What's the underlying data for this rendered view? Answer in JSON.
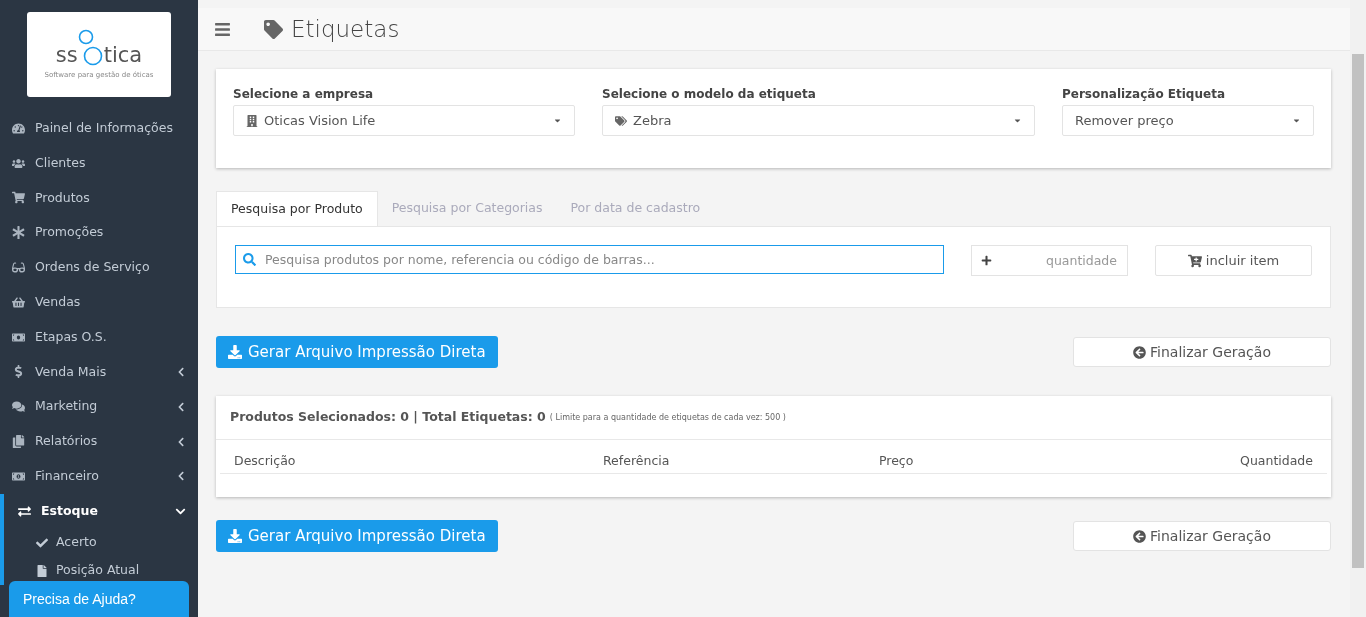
{
  "logo": {
    "name_start": "ss",
    "name_end": "tica",
    "tagline": "Software para gestão de óticas"
  },
  "sidebar": {
    "items": [
      {
        "label": "Painel de Informações",
        "kind": "link",
        "selected": false
      },
      {
        "label": "Clientes",
        "kind": "link",
        "selected": false
      },
      {
        "label": "Produtos",
        "kind": "link",
        "selected": false
      },
      {
        "label": "Promoções",
        "kind": "link",
        "selected": false
      },
      {
        "label": "Ordens de Serviço",
        "kind": "link",
        "selected": false
      },
      {
        "label": "Vendas",
        "kind": "link",
        "selected": false
      },
      {
        "label": "Etapas O.S.",
        "kind": "link",
        "selected": false
      },
      {
        "label": "Venda Mais",
        "kind": "group",
        "selected": false,
        "expanded": false
      },
      {
        "label": "Marketing",
        "kind": "group",
        "selected": false,
        "expanded": false
      },
      {
        "label": "Relatórios",
        "kind": "group",
        "selected": false,
        "expanded": false
      },
      {
        "label": "Financeiro",
        "kind": "group",
        "selected": false,
        "expanded": false
      },
      {
        "label": "Estoque",
        "kind": "group",
        "selected": true,
        "expanded": true,
        "children": [
          {
            "label": "Acerto"
          },
          {
            "label": "Posição Atual"
          }
        ]
      }
    ]
  },
  "help_button": "Precisa de Ajuda?",
  "page_title": "Etiquetas",
  "filters": [
    {
      "label": "Selecione a empresa",
      "value": "Oticas Vision Life"
    },
    {
      "label": "Selecione o modelo da etiqueta",
      "value": "Zebra"
    },
    {
      "label": "Personalização Etiqueta",
      "value": "Remover preço"
    }
  ],
  "tabs": [
    {
      "label": "Pesquisa por Produto",
      "selected": true
    },
    {
      "label": "Pesquisa por Categorias",
      "selected": false
    },
    {
      "label": "Por data de cadastro",
      "selected": false
    }
  ],
  "search": {
    "placeholder": "Pesquisa produtos por nome, referencia ou código de barras..."
  },
  "quantity": {
    "placeholder": "quantidade"
  },
  "add_button": "incluir item",
  "action_rows": [
    {
      "generate_button": "Gerar Arquivo Impressão Direta",
      "finish_button": "Finalizar Geração"
    },
    {
      "generate_button": "Gerar Arquivo Impressão Direta",
      "finish_button": "Finalizar Geração"
    }
  ],
  "summary": {
    "text": "Produtos Selecionados: 0 | Total Etiquetas: 0",
    "note": "( Limite para a quantidade de etiquetas de cada vez: 500 )"
  },
  "table": {
    "columns": [
      "Descrição",
      "Referência",
      "Preço",
      "Quantidade"
    ]
  }
}
